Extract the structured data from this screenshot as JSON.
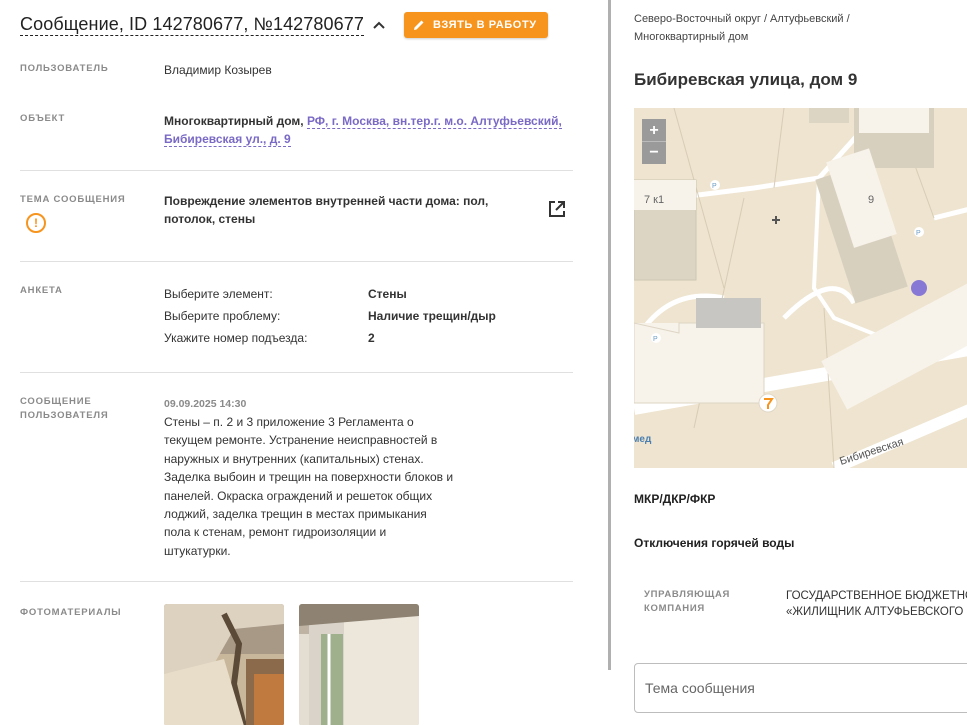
{
  "header": {
    "title": "Сообщение, ID 142780677, №142780677",
    "take_button": "ВЗЯТЬ В РАБОТУ"
  },
  "user": {
    "label": "ПОЛЬЗОВАТЕЛЬ",
    "value": "Владимир Козырев"
  },
  "object": {
    "label": "ОБЪЕКТ",
    "type": "Многоквартирный дом,",
    "address_line1": "РФ, г. Москва, вн.тер.г. м.о. Алтуфьевский,",
    "address_line2": "Бибиревская ул., д. 9"
  },
  "topic": {
    "label": "ТЕМА СООБЩЕНИЯ",
    "line1": "Повреждение элементов внутренней части дома: пол,",
    "line2": "потолок, стены"
  },
  "survey": {
    "label": "АНКЕТА",
    "items": [
      {
        "q": "Выберите элемент:",
        "a": "Стены"
      },
      {
        "q": "Выберите проблему:",
        "a": "Наличие трещин/дыр"
      },
      {
        "q": "Укажите номер подъезда:",
        "a": "2"
      }
    ]
  },
  "message": {
    "label1": "СООБЩЕНИЕ",
    "label2": "ПОЛЬЗОВАТЕЛЯ",
    "date": "09.09.2025 14:30",
    "lines": [
      "Стены – п. 2 и 3 приложение 3 Регламента о",
      "текущем ремонте. Устранение неисправностей в",
      "наружных и внутренних (капитальных) стенах.",
      "Заделка выбоин и трещин на поверхности блоков и",
      "панелей. Окраска ограждений и решеток общих",
      "лоджий, заделка трещин в местах примыкания",
      "пола к стенам, ремонт гидроизоляции и",
      "штукатурки."
    ]
  },
  "photos": {
    "label": "ФОТОМАТЕРИАЛЫ"
  },
  "right": {
    "breadcrumb1": "Северо-Восточный округ / Алтуфьевский /",
    "breadcrumb2": "Многоквартирный дом",
    "address": "Бибиревская улица, дом 9",
    "map": {
      "zoom_in": "+",
      "zoom_out": "−",
      "label_7k1": "7 к1",
      "label_9": "9",
      "street": "Бибиревская",
      "edge_text": "мед",
      "parking": "P"
    },
    "section1": "МКР/ДКР/ФКР",
    "section2": "Отключения горячей воды",
    "mgmt_label1": "УПРАВЛЯЮЩАЯ",
    "mgmt_label2": "КОМПАНИЯ",
    "mgmt_value1": "ГОСУДАРСТВЕННОЕ БЮДЖЕТНОЕ УЧРЕЖДЕНИЕ",
    "mgmt_value2": "«ЖИЛИЩНИК АЛТУФЬЕВСКОГО РАЙОНА»",
    "topic_placeholder": "Тема сообщения"
  },
  "colors": {
    "accent": "#f7941d",
    "link": "#7a69c5",
    "map_marker": "#8878d6"
  }
}
